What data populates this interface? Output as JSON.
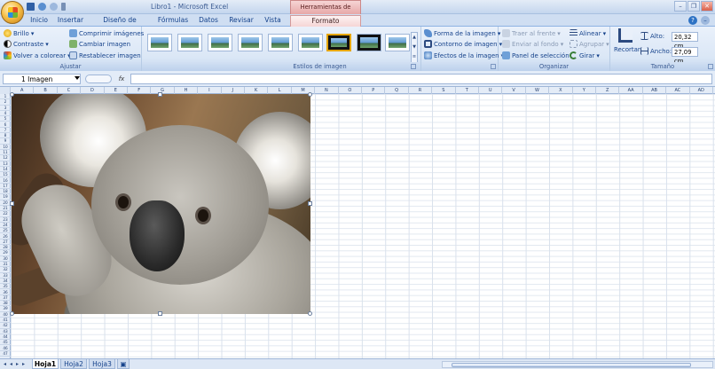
{
  "window": {
    "title": "Libro1 - Microsoft Excel",
    "context_tab": "Herramientas de imagen"
  },
  "tabs": [
    "Inicio",
    "Insertar",
    "Diseño de página",
    "Fórmulas",
    "Datos",
    "Revisar",
    "Vista",
    "Formato"
  ],
  "ribbon": {
    "adjust": {
      "label": "Ajustar",
      "brightness": "Brillo",
      "contrast": "Contraste",
      "recolor": "Volver a colorear",
      "compress": "Comprimir imágenes",
      "change": "Cambiar imagen",
      "reset": "Restablecer imagen"
    },
    "styles": {
      "label": "Estilos de imagen",
      "shape": "Forma de la imagen",
      "border": "Contorno de imagen",
      "effects": "Efectos de la imagen"
    },
    "arrange": {
      "label": "Organizar",
      "bring_front": "Traer al frente",
      "send_back": "Enviar al fondo",
      "selection_pane": "Panel de selección",
      "align": "Alinear",
      "group": "Agrupar",
      "rotate": "Girar"
    },
    "size": {
      "label": "Tamaño",
      "crop": "Recortar",
      "height_label": "Alto:",
      "height_value": "20,32 cm",
      "width_label": "Ancho:",
      "width_value": "27,09 cm"
    }
  },
  "formula_bar": {
    "name_box": "1 Imagen",
    "fx": "fx"
  },
  "columns": [
    "A",
    "B",
    "C",
    "D",
    "E",
    "F",
    "G",
    "H",
    "I",
    "J",
    "K",
    "L",
    "M",
    "N",
    "O",
    "P",
    "Q",
    "R",
    "S",
    "T",
    "U",
    "V",
    "W",
    "X",
    "Y",
    "Z",
    "AA",
    "AB",
    "AC",
    "AD"
  ],
  "rows": [
    "1",
    "2",
    "3",
    "4",
    "5",
    "6",
    "7",
    "8",
    "9",
    "10",
    "11",
    "12",
    "13",
    "14",
    "15",
    "16",
    "17",
    "18",
    "19",
    "20",
    "21",
    "22",
    "23",
    "24",
    "25",
    "26",
    "27",
    "28",
    "29",
    "30",
    "31",
    "32",
    "33",
    "34",
    "35",
    "36",
    "37",
    "38",
    "39",
    "40",
    "41",
    "42",
    "43",
    "44",
    "45",
    "46",
    "47"
  ],
  "sheets": [
    "Hoja1",
    "Hoja2",
    "Hoja3"
  ]
}
